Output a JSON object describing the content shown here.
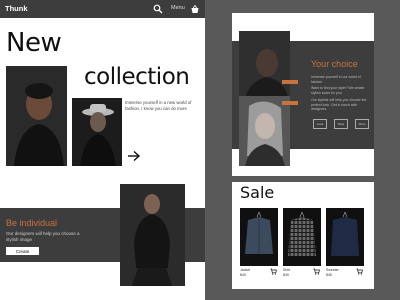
{
  "header": {
    "brand": "Thunk",
    "menu_label": "Menu",
    "search_icon": "search-icon",
    "bag_icon": "shopping-bag-icon"
  },
  "hero": {
    "title_line1": "New",
    "title_line2": "collection",
    "description": "Immerse yourself in a new world of fashion. I know you can do more",
    "arrow_icon": "arrow-right-icon"
  },
  "individual": {
    "title": "Be individual",
    "description": "Our designers will help you choose a stylish image",
    "button_label": "Create"
  },
  "choice": {
    "title": "Your choice",
    "paragraphs": [
      "Immerse yourself in our world of fashion.",
      "Want to find your style? We create stylish looks for you.",
      "Our stylists will help you choose the perfect look. Get in touch with designers."
    ],
    "buttons": [
      "Look",
      "Style",
      "More"
    ]
  },
  "sale": {
    "title": "Sale",
    "products": [
      {
        "name": "Jacket",
        "price": "$49"
      },
      {
        "name": "Shirt",
        "price": "$39"
      },
      {
        "name": "Sweater",
        "price": "$45"
      }
    ]
  },
  "colors": {
    "accent": "#c8733e",
    "dark": "#3d3d3d",
    "background": "#595959"
  }
}
